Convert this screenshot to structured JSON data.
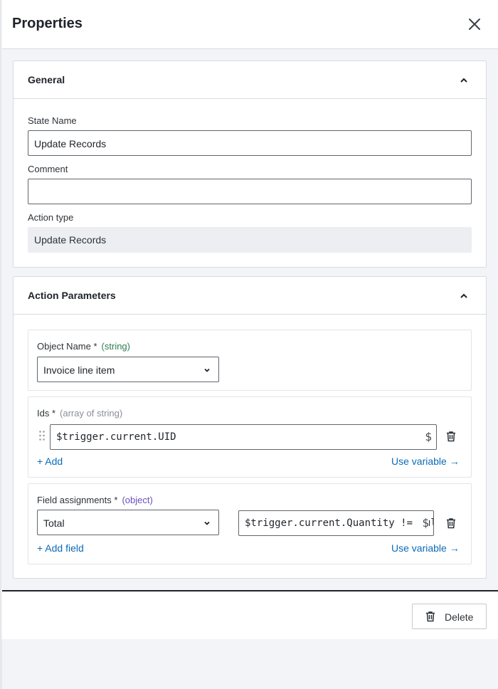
{
  "header": {
    "title": "Properties"
  },
  "general": {
    "title": "General",
    "state_name_label": "State Name",
    "state_name_value": "Update Records",
    "comment_label": "Comment",
    "comment_value": "",
    "action_type_label": "Action type",
    "action_type_value": "Update Records"
  },
  "params": {
    "title": "Action Parameters",
    "object_name": {
      "label": "Object Name *",
      "type_hint": "(string)",
      "type_color": "#2e7d4f",
      "selected": "Invoice line item"
    },
    "ids": {
      "label": "Ids *",
      "type_hint": "(array of string)",
      "type_color": "#8a8f95",
      "value": "$trigger.current.UID",
      "dollar": "$",
      "add_label": "+ Add",
      "use_variable_label": "Use variable →"
    },
    "fields": {
      "label": "Field assignments *",
      "type_hint": "(object)",
      "type_color": "#6b4fbb",
      "field_selected": "Total",
      "value": "$trigger.current.Quantity != null",
      "dollar": "$",
      "add_label": "+ Add field",
      "use_variable_label": "Use variable →"
    }
  },
  "footer": {
    "delete_label": "Delete"
  },
  "colors": {
    "link": "#0b6bb8",
    "border": "#5f666d"
  }
}
